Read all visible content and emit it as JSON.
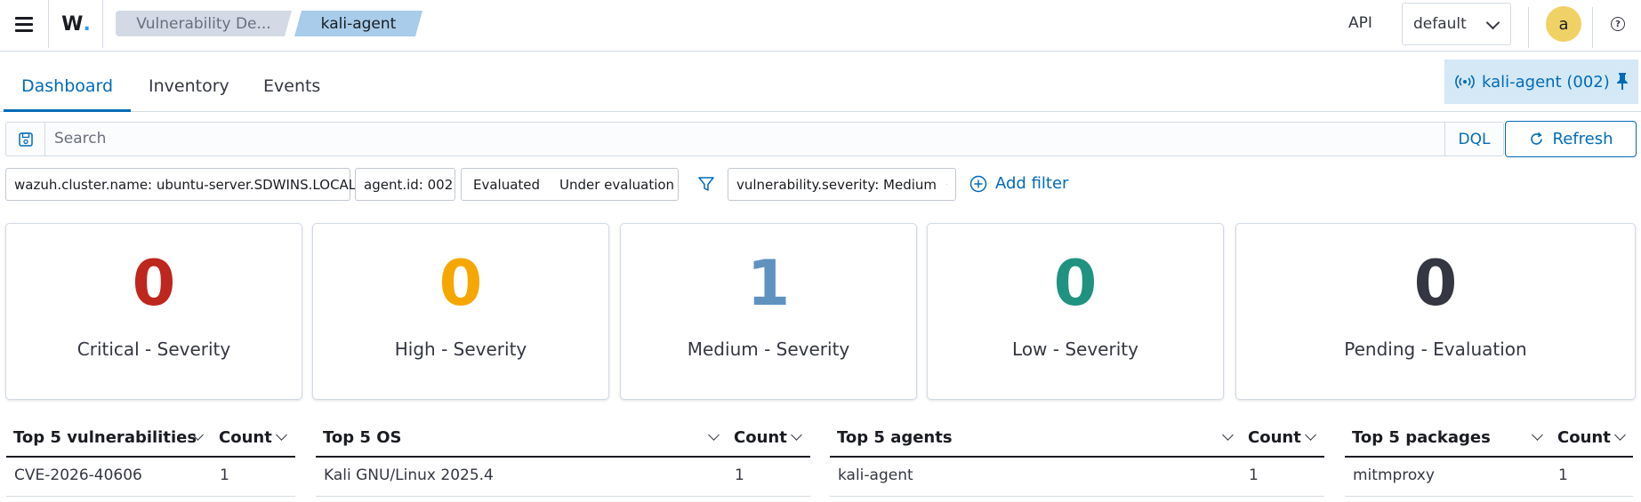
{
  "header": {
    "logo": "W",
    "breadcrumbs": [
      "Vulnerability De...",
      "kali-agent"
    ],
    "api_label": "API",
    "space_selector": "default",
    "avatar_initial": "a",
    "help_glyph": "?"
  },
  "tabs": [
    "Dashboard",
    "Inventory",
    "Events"
  ],
  "active_tab": "Dashboard",
  "pinned_agent": "kali-agent (002)",
  "search": {
    "placeholder": "Search",
    "value": "",
    "language": "DQL",
    "refresh_label": "Refresh"
  },
  "filters": {
    "pinned": [
      "wazuh.cluster.name: ubuntu-server.SDWINS.LOCAL",
      "agent.id: 002"
    ],
    "toggle": [
      "Evaluated",
      "Under evaluation"
    ],
    "applied": [
      "vulnerability.severity: Medium"
    ],
    "add_filter_label": "Add filter"
  },
  "cards": [
    {
      "value": "0",
      "label": "Critical - Severity",
      "color": "#bd271e"
    },
    {
      "value": "0",
      "label": "High - Severity",
      "color": "#f5a700"
    },
    {
      "value": "1",
      "label": "Medium - Severity",
      "color": "#6092c0"
    },
    {
      "value": "0",
      "label": "Low - Severity",
      "color": "#209280"
    },
    {
      "value": "0",
      "label": "Pending - Evaluation",
      "color": "#343741"
    }
  ],
  "tables": [
    {
      "title": "Top 5 vulnerabilities",
      "count_header": "Count",
      "rows": [
        {
          "name": "CVE-2026-40606",
          "count": "1"
        }
      ]
    },
    {
      "title": "Top 5 OS",
      "count_header": "Count",
      "rows": [
        {
          "name": "Kali GNU/Linux 2025.4",
          "count": "1"
        }
      ]
    },
    {
      "title": "Top 5 agents",
      "count_header": "Count",
      "rows": [
        {
          "name": "kali-agent",
          "count": "1"
        }
      ]
    },
    {
      "title": "Top 5 packages",
      "count_header": "Count",
      "rows": [
        {
          "name": "mitmproxy",
          "count": "1"
        }
      ]
    }
  ],
  "colors": {
    "accent": "#006bb8",
    "breadcrumb_active_bg": "#a8cce9",
    "breadcrumb_bg": "#d3dae6",
    "pinned_agent_bg": "#d4e8f6",
    "logo_dot": "#3595f9",
    "avatar_bg": "#f0d165"
  },
  "icons": {
    "menu": "hamburger-menu-icon",
    "save_query": "save-query-icon",
    "refresh": "refresh-icon",
    "filter": "filter-icon",
    "add_filter": "plus-circle-icon",
    "remove_filter": "close-icon",
    "agent": "broadcast-icon",
    "pin": "pin-icon",
    "help": "help-icon",
    "sort": "chevron-down-icon"
  }
}
